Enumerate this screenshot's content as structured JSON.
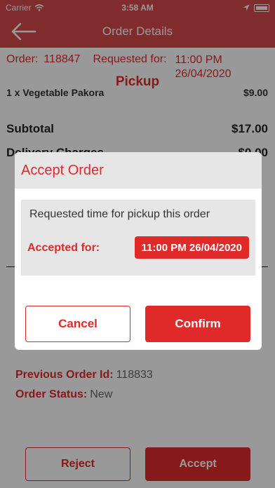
{
  "status_bar": {
    "carrier": "Carrier",
    "time": "3:58 AM"
  },
  "nav": {
    "title": "Order Details",
    "back_icon": "arrow-left-icon"
  },
  "order": {
    "order_label": "Order:",
    "order_id": "118847",
    "requested_label": "Requested for:",
    "requested_time": "11:00 PM",
    "requested_date": "26/04/2020",
    "type": "Pickup"
  },
  "items": {
    "cut_line": "1 x Vegetable Pakora",
    "cut_price": "$9.00"
  },
  "summary": {
    "subtotal_label": "Subtotal",
    "subtotal_value": "$17.00",
    "delivery_label": "Delivery Charges",
    "delivery_value": "$0.00"
  },
  "previous": {
    "prev_label": "Previous Order Id:",
    "prev_value": "118833",
    "status_label": "Order Status:",
    "status_value": "New"
  },
  "actions": {
    "reject": "Reject",
    "accept": "Accept"
  },
  "modal": {
    "title": "Accept Order",
    "description": "Requested time for pickup this order",
    "accepted_label": "Accepted for:",
    "accepted_time": "11:00 PM 26/04/2020",
    "cancel": "Cancel",
    "confirm": "Confirm"
  },
  "colors": {
    "brand_red": "#e02a2a",
    "nav_red": "#d84a4a"
  }
}
